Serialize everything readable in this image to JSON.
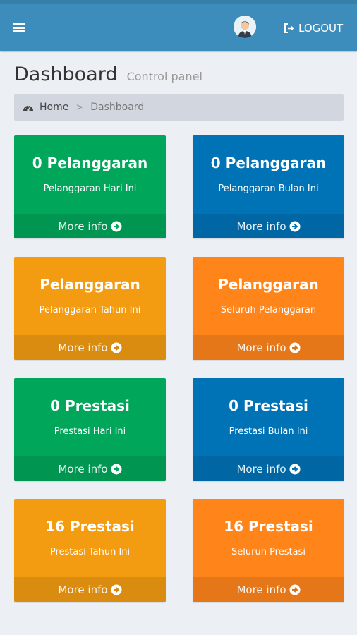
{
  "header": {
    "logout_label": "LOGOUT"
  },
  "content": {
    "title": "Dashboard",
    "subtitle": "Control panel"
  },
  "breadcrumb": {
    "home": "Home",
    "separator": ">",
    "current": "Dashboard"
  },
  "boxes": [
    {
      "title": "0 Pelanggaran",
      "subtitle": "Pelanggaran Hari Ini",
      "footer": "More info",
      "color": "#00a65a"
    },
    {
      "title": "0 Pelanggaran",
      "subtitle": "Pelanggaran Bulan Ini",
      "footer": "More info",
      "color": "#0073b7"
    },
    {
      "title": "Pelanggaran",
      "subtitle": "Pelanggaran Tahun Ini",
      "footer": "More info",
      "color": "#f39c12"
    },
    {
      "title": "Pelanggaran",
      "subtitle": "Seluruh Pelanggaran",
      "footer": "More info",
      "color": "#ff851b"
    },
    {
      "title": "0 Prestasi",
      "subtitle": "Prestasi Hari Ini",
      "footer": "More info",
      "color": "#00a65a"
    },
    {
      "title": "0 Prestasi",
      "subtitle": "Prestasi Bulan Ini",
      "footer": "More info",
      "color": "#0073b7"
    },
    {
      "title": "16 Prestasi",
      "subtitle": "Prestasi Tahun Ini",
      "footer": "More info",
      "color": "#f39c12"
    },
    {
      "title": "16 Prestasi",
      "subtitle": "Seluruh Prestasi",
      "footer": "More info",
      "color": "#ff851b"
    }
  ],
  "icons": {
    "menu": "hamburger-menu-icon",
    "avatar": "user-avatar",
    "logout": "sign-out-icon",
    "home": "dashboard-gauge-icon",
    "more": "arrow-circle-right-icon"
  },
  "colors": {
    "header": "#3c8dbc",
    "background": "#ecf0f5",
    "breadcrumb_bg": "#d2d6de"
  }
}
